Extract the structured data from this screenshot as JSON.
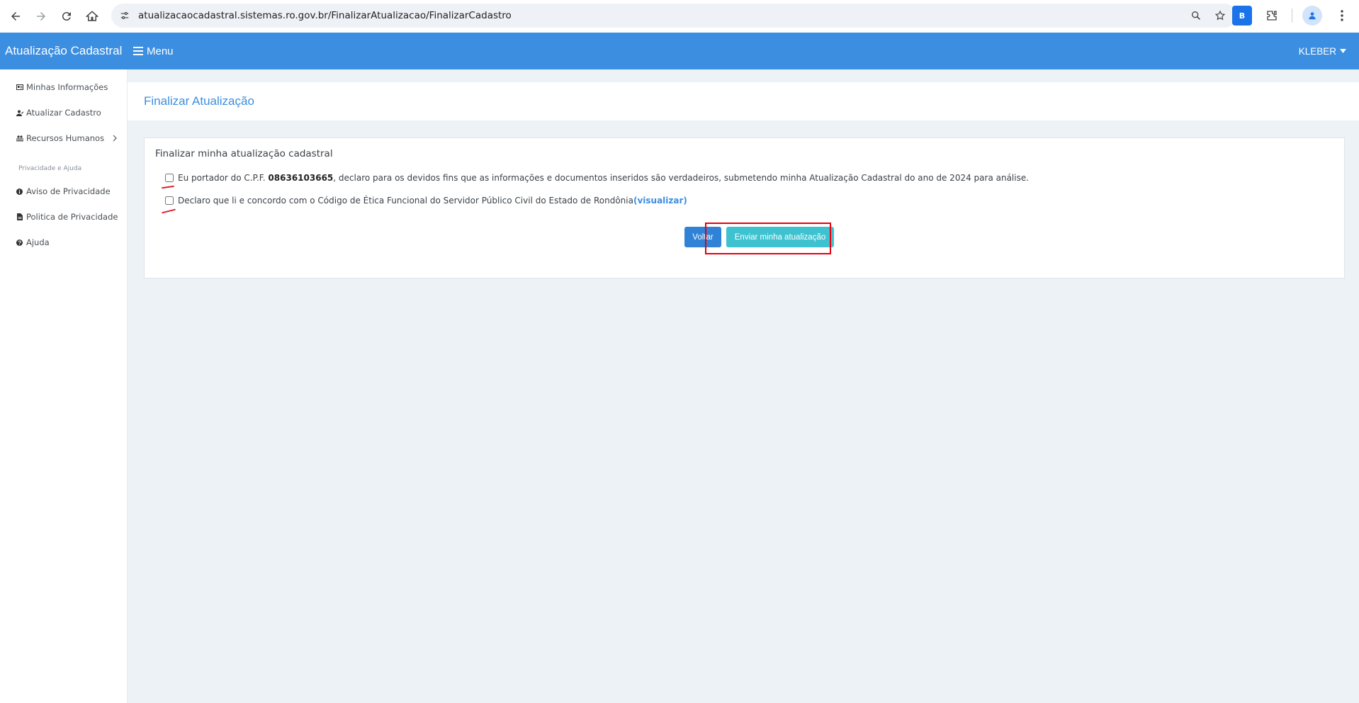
{
  "browser": {
    "url": "atualizacaocadastral.sistemas.ro.gov.br/FinalizarAtualizacao/FinalizarCadastro",
    "extension_letter": "B"
  },
  "header": {
    "brand": "Atualização Cadastral",
    "menu_label": "Menu",
    "user_label": "KLEBER"
  },
  "sidebar": {
    "items": [
      {
        "label": "Minhas Informações",
        "icon": "id-card-icon"
      },
      {
        "label": "Atualizar Cadastro",
        "icon": "user-edit-icon"
      },
      {
        "label": "Recursos Humanos",
        "icon": "users-icon"
      }
    ],
    "section_title": "Privacidade e Ajuda",
    "privacy_items": [
      {
        "label": "Aviso de Privacidade",
        "icon": "info-circle-icon"
      },
      {
        "label": "Politica de Privacidade",
        "icon": "file-icon"
      },
      {
        "label": "Ajuda",
        "icon": "question-circle-icon"
      }
    ]
  },
  "main": {
    "page_title": "Finalizar Atualização",
    "card_title": "Finalizar minha atualização cadastral",
    "declaration1": {
      "prefix": "Eu portador do C.P.F. ",
      "cpf": "08636103665",
      "suffix": ", declaro para os devidos fins que as informações e documentos inseridos são verdadeiros, submetendo minha Atualização Cadastral do ano de 2024 para análise.",
      "checked": false
    },
    "declaration2": {
      "text": "Declaro que li e concordo com o Código de Ética Funcional do Servidor Público Civil do Estado de Rondônia ",
      "link": "(visualizar)",
      "checked": false
    },
    "back_button": "Voltar",
    "submit_button": "Enviar minha atualização"
  },
  "colors": {
    "header_bg": "#3b8ee0",
    "submit_bg": "#3ec2d0",
    "back_bg": "#2f82d6",
    "highlight": "#e8000e",
    "page_bg": "#edf2f7"
  }
}
